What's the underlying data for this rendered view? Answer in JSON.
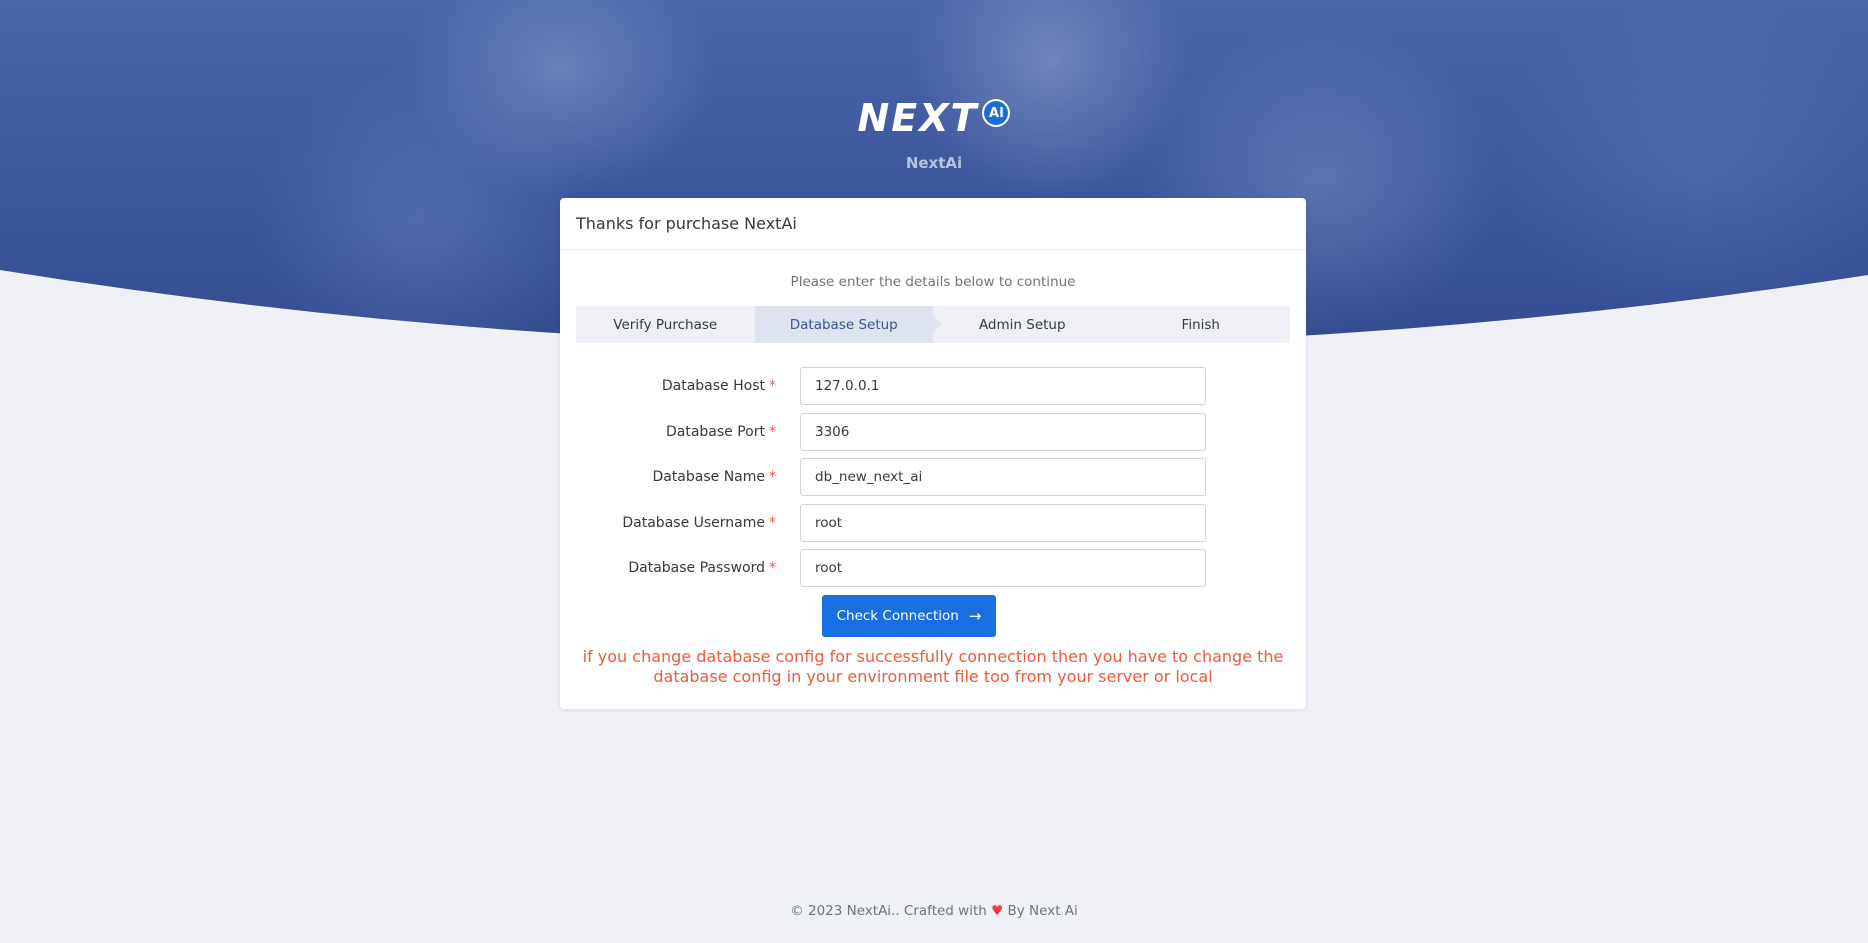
{
  "brand": {
    "logo_text": "NEXT",
    "logo_badge": "AI",
    "name": "NextAi"
  },
  "card": {
    "title": "Thanks for purchase NextAi",
    "subtitle": "Please enter the details below to continue"
  },
  "steps": [
    {
      "label": "Verify Purchase",
      "active": false
    },
    {
      "label": "Database Setup",
      "active": true
    },
    {
      "label": "Admin Setup",
      "active": false
    },
    {
      "label": "Finish",
      "active": false
    }
  ],
  "form": {
    "fields": [
      {
        "label": "Database Host",
        "required_mark": "*",
        "value": "127.0.0.1"
      },
      {
        "label": "Database Port",
        "required_mark": "*",
        "value": "3306"
      },
      {
        "label": "Database Name",
        "required_mark": "*",
        "value": "db_new_next_ai"
      },
      {
        "label": "Database Username",
        "required_mark": "*",
        "value": "root"
      },
      {
        "label": "Database Password",
        "required_mark": "*",
        "value": "root"
      }
    ],
    "submit_label": "Check Connection",
    "submit_icon": "arrow-right-icon",
    "warning": "if you change database config for successfully connection then you have to change the database config in your environment file too from your server or local"
  },
  "footer": {
    "prefix": "© 2023 NextAi.. Crafted with",
    "heart_icon": "heart-icon",
    "suffix": "By Next Ai"
  },
  "colors": {
    "primary": "#1a6fe0",
    "warning": "#f05a3a",
    "required": "#f05454",
    "hero": "#3d569c"
  }
}
